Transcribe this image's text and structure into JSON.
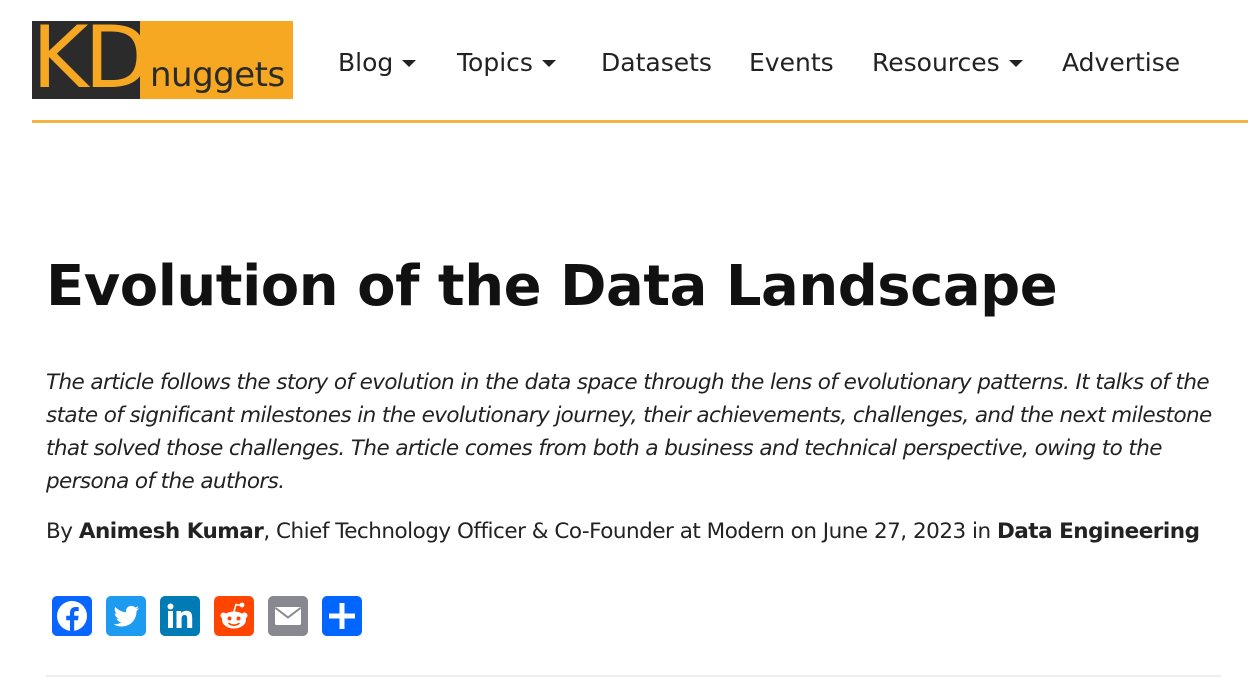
{
  "logo": {
    "kd_text": "KD",
    "nuggets_text": "nuggets"
  },
  "nav": {
    "items": [
      {
        "label": "Blog",
        "has_dropdown": true
      },
      {
        "label": "Topics",
        "has_dropdown": true
      },
      {
        "label": "Datasets",
        "has_dropdown": false
      },
      {
        "label": "Events",
        "has_dropdown": false
      },
      {
        "label": "Resources",
        "has_dropdown": true
      },
      {
        "label": "Advertise",
        "has_dropdown": false
      }
    ]
  },
  "article": {
    "title": "Evolution of the Data Landscape",
    "excerpt": "The article follows the story of evolution in the data space through the lens of evolutionary patterns. It talks of the state of significant milestones in the evolutionary journey, their achievements, challenges, and the next milestone that solved those challenges. The article comes from both a business and technical perspective, owing to the persona of the authors.",
    "byline": {
      "by": "By ",
      "author": "Animesh Kumar",
      "role": ", Chief Technology Officer & Co-Founder at Modern on June 27, 2023 in ",
      "category": "Data Engineering"
    }
  },
  "share": {
    "buttons": [
      {
        "name": "facebook",
        "icon": "facebook-icon",
        "color": "#0866ff"
      },
      {
        "name": "twitter",
        "icon": "twitter-icon",
        "color": "#1d9bf0"
      },
      {
        "name": "linkedin",
        "icon": "linkedin-icon",
        "color": "#007bb5"
      },
      {
        "name": "reddit",
        "icon": "reddit-icon",
        "color": "#ff4500"
      },
      {
        "name": "email",
        "icon": "email-icon",
        "color": "#888990"
      },
      {
        "name": "share",
        "icon": "share-icon",
        "color": "#0166ff"
      }
    ]
  },
  "colors": {
    "brand_orange": "#f7a823",
    "logo_dark": "#2b2b2b",
    "header_rule": "#f2b542"
  }
}
